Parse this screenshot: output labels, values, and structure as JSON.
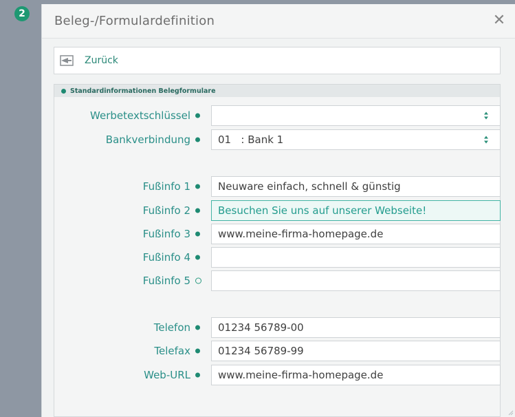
{
  "badge": {
    "number": "2"
  },
  "dialog": {
    "title": "Beleg-/Formulardefinition",
    "close_symbol": "✕",
    "back_label": "Zurück"
  },
  "panel": {
    "title": "Standardinformationen Belegformulare"
  },
  "fields": {
    "werbetext": {
      "label": "Werbetextschlüssel",
      "value": ""
    },
    "bank": {
      "label": "Bankverbindung",
      "value": "01   : Bank 1"
    },
    "fuss1": {
      "label": "Fußinfo 1",
      "value": "Neuware einfach, schnell & günstig"
    },
    "fuss2": {
      "label": "Fußinfo 2",
      "value": "Besuchen Sie uns auf unserer Webseite!"
    },
    "fuss3": {
      "label": "Fußinfo 3",
      "value": "www.meine-firma-homepage.de"
    },
    "fuss4": {
      "label": "Fußinfo 4",
      "value": ""
    },
    "fuss5": {
      "label": "Fußinfo 5",
      "value": ""
    },
    "telefon": {
      "label": "Telefon",
      "value": "01234 56789-00"
    },
    "telefax": {
      "label": "Telefax",
      "value": "01234 56789-99"
    },
    "weburl": {
      "label": "Web-URL",
      "value": "www.meine-firma-homepage.de"
    }
  },
  "colors": {
    "accent": "#1e8a72",
    "label_text": "#2a8f88",
    "badge": "#1e9872"
  },
  "icons": {
    "back": "back-arrow-icon",
    "close": "close-icon",
    "select": "select-arrows-icon",
    "required": "filled-dot-icon",
    "optional": "hollow-dot-icon"
  }
}
